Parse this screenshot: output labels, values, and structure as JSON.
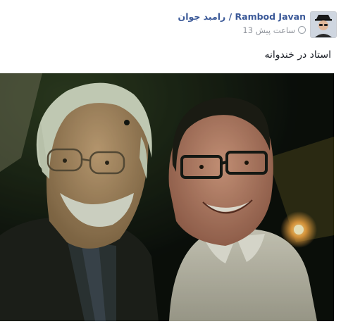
{
  "post": {
    "author": "رامبد جوان / Rambod Javan",
    "timestamp": "13 ساعت پیش",
    "caption": "استاد در خندوانه",
    "icons": {
      "avatar": "profile-avatar",
      "clock": "clock-icon"
    },
    "colors": {
      "name": "#3b5998",
      "timestamp": "#90949c",
      "caption": "#1d2129"
    }
  }
}
